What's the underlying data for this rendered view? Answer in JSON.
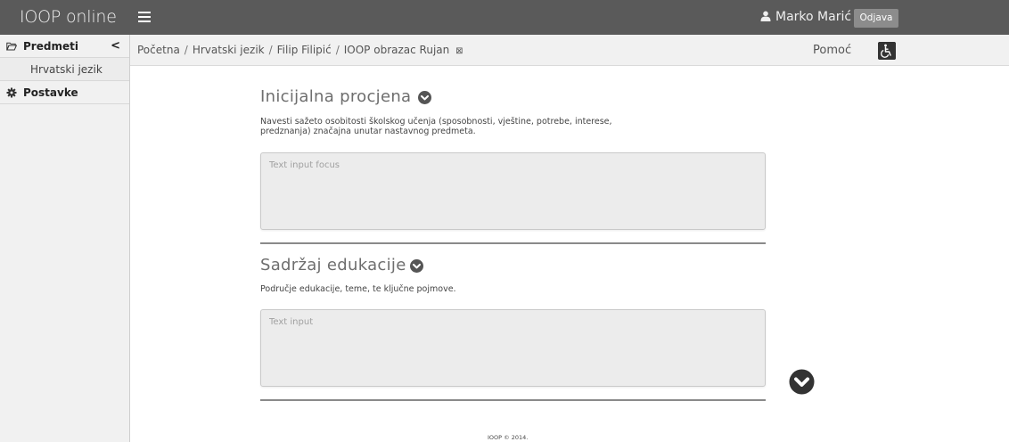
{
  "header": {
    "brand": "IOOP online",
    "user_name": "Marko Marić",
    "logout_label": "Odjava"
  },
  "sidebar": {
    "items": [
      {
        "label": "Predmeti",
        "icon": "folder-open-icon",
        "chevron": "<"
      },
      {
        "label": "Hrvatski jezik"
      },
      {
        "label": "Postavke",
        "icon": "gear-icon"
      }
    ]
  },
  "breadcrumb": {
    "items": [
      "Početna",
      "Hrvatski jezik",
      "Filip Filipić",
      "IOOP obrazac Rujan"
    ],
    "separator": "/",
    "end_glyph": "⊠"
  },
  "help_label": "Pomoć",
  "sections": [
    {
      "title": "Inicijalna procjena",
      "description": "Navesti sažeto osobitosti školskog učenja (sposobnosti, vještine, potrebe, interese, predznanja) značajna unutar nastavnog predmeta.",
      "input_placeholder": "Text input focus",
      "input_value": ""
    },
    {
      "title": "Sadržaj edukacije",
      "description": "Područje edukacije, teme, te ključne pojmove.",
      "input_placeholder": "Text input",
      "input_value": ""
    }
  ],
  "footer": "IOOP © 2014.",
  "colors": {
    "topbar": "#5a5a5a",
    "sidebar": "#f1f1f1",
    "section_title": "#6e6e6e",
    "chevron": "#333333"
  }
}
